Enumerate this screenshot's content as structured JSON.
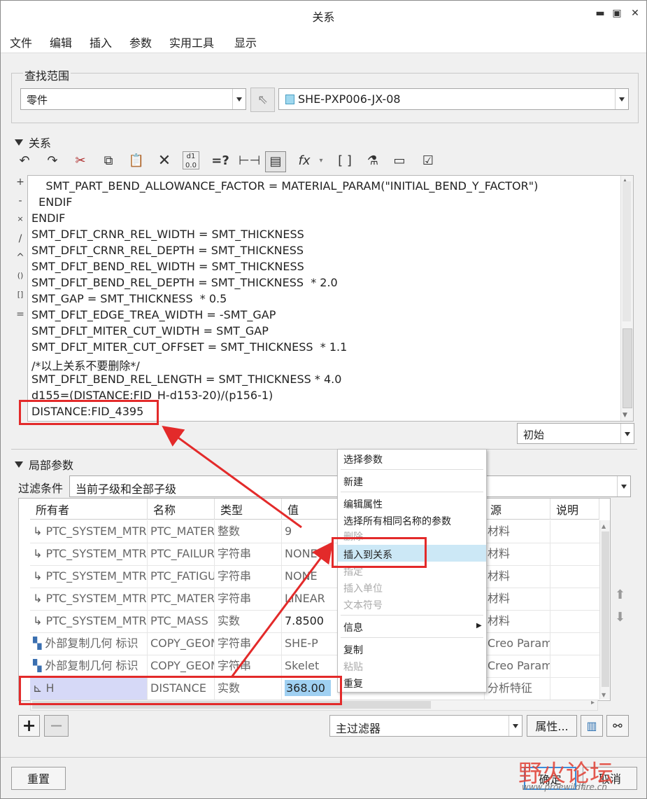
{
  "window": {
    "title": "关系"
  },
  "menu": [
    "文件",
    "编辑",
    "插入",
    "参数",
    "实用工具",
    "显示"
  ],
  "lookup": {
    "label": "查找范围",
    "scope": "零件",
    "model": "SHE-PXP006-JX-08"
  },
  "relations": {
    "label": "关系",
    "side_symbols": [
      "+",
      "-",
      "×",
      "/",
      "^",
      "()",
      "[]",
      "="
    ],
    "lines": [
      "    SMT_PART_BEND_ALLOWANCE_FACTOR = MATERIAL_PARAM(\"INITIAL_BEND_Y_FACTOR\")",
      "  ENDIF",
      "ENDIF",
      "SMT_DFLT_CRNR_REL_WIDTH = SMT_THICKNESS",
      "SMT_DFLT_CRNR_REL_DEPTH = SMT_THICKNESS",
      "SMT_DFLT_BEND_REL_WIDTH = SMT_THICKNESS",
      "SMT_DFLT_BEND_REL_DEPTH = SMT_THICKNESS  * 2.0",
      "SMT_GAP = SMT_THICKNESS  * 0.5",
      "SMT_DFLT_EDGE_TREA_WIDTH = -SMT_GAP",
      "SMT_DFLT_MITER_CUT_WIDTH = SMT_GAP",
      "SMT_DFLT_MITER_CUT_OFFSET = SMT_THICKNESS  * 1.1",
      "/*以上关系不要删除*/",
      "SMT_DFLT_BEND_REL_LENGTH = SMT_THICKNESS * 4.0",
      "d155=(DISTANCE:FID_H-d153-20)/(p156-1)",
      "DISTANCE:FID_4395"
    ],
    "units_mode": "初始"
  },
  "local_params": {
    "label": "局部参数",
    "filter_label": "过滤条件",
    "filter_value": "当前子级和全部子级",
    "columns": [
      "所有者",
      "名称",
      "类型",
      "值",
      "源",
      "说明"
    ],
    "rows": [
      {
        "owner": "PTC_SYSTEM_MTRL",
        "name": "PTC_MATERIAL",
        "type": "整数",
        "value": "9",
        "source": "材料"
      },
      {
        "owner": "PTC_SYSTEM_MTRL",
        "name": "PTC_FAILURE",
        "type": "字符串",
        "value": "NONE",
        "source": "材料"
      },
      {
        "owner": "PTC_SYSTEM_MTRL",
        "name": "PTC_FATIGUE",
        "type": "字符串",
        "value": "NONE",
        "source": "材料"
      },
      {
        "owner": "PTC_SYSTEM_MTRL",
        "name": "PTC_MATERIAL",
        "type": "字符串",
        "value": "LINEAR",
        "source": "材料"
      },
      {
        "owner": "PTC_SYSTEM_MTRL",
        "name": "PTC_MASS",
        "type": "实数",
        "value": "7.8500",
        "source": "材料"
      },
      {
        "owner": "外部复制几何 标识",
        "name": "COPY_GEOM",
        "type": "字符串",
        "value": "SHE-P",
        "source": "Creo Param"
      },
      {
        "owner": "外部复制几何 标识",
        "name": "COPY_GEOM",
        "type": "字符串",
        "value": "Skelet",
        "source": "Creo Param"
      },
      {
        "owner": "H",
        "name": "DISTANCE",
        "type": "实数",
        "value": "368.00",
        "source": "分析特征"
      }
    ],
    "main_filter": "主过滤器",
    "properties_button": "属性..."
  },
  "context_menu": {
    "items": [
      "选择参数",
      "新建",
      "编辑属性",
      "选择所有相同名称的参数",
      "删除",
      "插入到关系",
      "指定",
      "插入单位",
      "文本符号",
      "信息",
      "复制",
      "粘贴",
      "重复"
    ],
    "highlighted": "插入到关系"
  },
  "buttons": {
    "reset": "重置",
    "ok": "确定",
    "cancel": "取消"
  },
  "watermark": {
    "brand": "野火论坛",
    "url": "www.proewildfire.cn"
  },
  "colors": {
    "highlight": "#cce8f6",
    "annotation_red": "#e32a2a",
    "selected_row": "#d6d9f7"
  }
}
